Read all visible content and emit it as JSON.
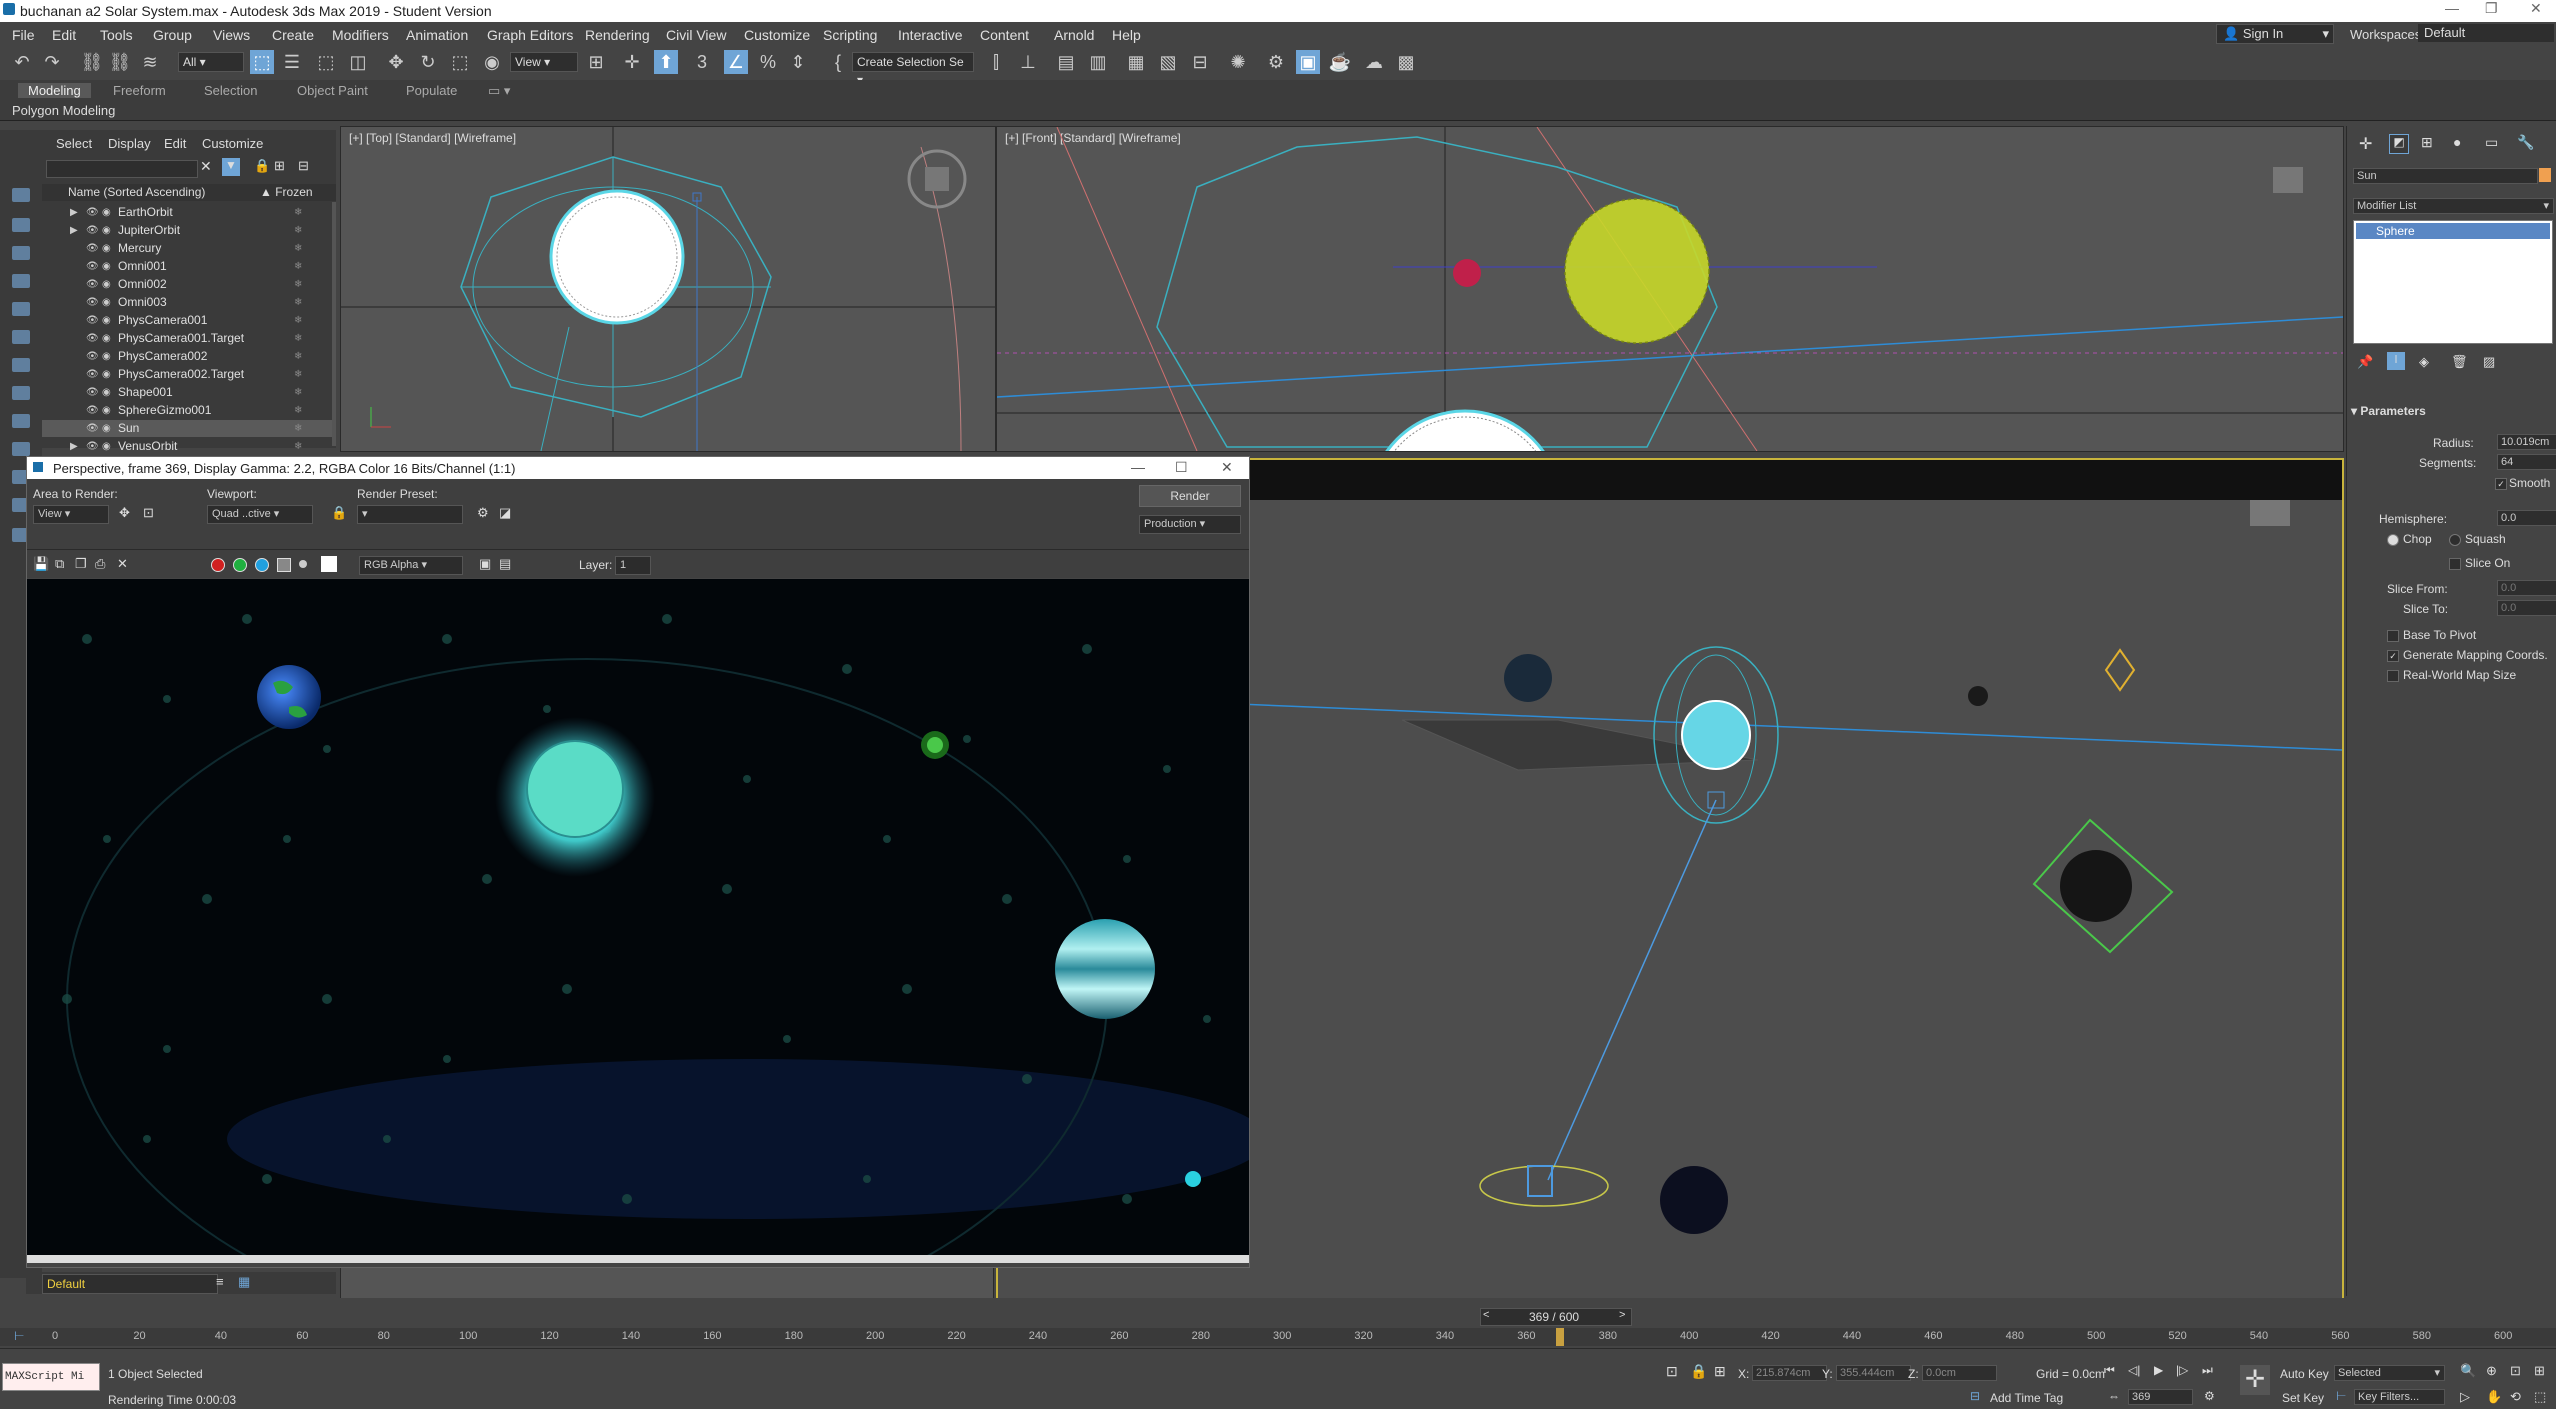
{
  "window": {
    "title": "buchanan a2 Solar System.max - Autodesk 3ds Max 2019 - Student Version",
    "controls": [
      "—",
      "❐",
      "✕"
    ]
  },
  "menu": {
    "items": [
      "File",
      "Edit",
      "Tools",
      "Group",
      "Views",
      "Create",
      "Modifiers",
      "Animation",
      "Graph Editors",
      "Rendering",
      "Civil View",
      "Customize",
      "Scripting",
      "Interactive",
      "Content",
      "Arnold",
      "Help"
    ],
    "sign_in": "Sign In",
    "workspaces_label": "Workspaces:",
    "workspaces_value": "Default"
  },
  "toolbar": {
    "filter_value": "All",
    "coord_value": "View",
    "selection_set": "Create Selection Se"
  },
  "ribbon": {
    "tabs": [
      "Modeling",
      "Freeform",
      "Selection",
      "Object Paint",
      "Populate"
    ],
    "sub": "Polygon Modeling"
  },
  "scene_explorer": {
    "menu": [
      "Select",
      "Display",
      "Edit",
      "Customize"
    ],
    "col_name": "Name (Sorted Ascending)",
    "col_frozen": "▲ Frozen",
    "items": [
      "EarthOrbit",
      "JupiterOrbit",
      "Mercury",
      "Omni001",
      "Omni002",
      "Omni003",
      "PhysCamera001",
      "PhysCamera001.Target",
      "PhysCamera002",
      "PhysCamera002.Target",
      "Shape001",
      "SphereGizmo001",
      "Sun",
      "VenusOrbit"
    ],
    "selected": "Sun"
  },
  "viewports": {
    "top_label": "[+] [Top] [Standard] [Wireframe]",
    "front_label": "[+] [Front] [Standard] [Wireframe]"
  },
  "render_window": {
    "title": "Perspective, frame 369, Display Gamma: 2.2, RGBA Color 16 Bits/Channel (1:1)",
    "area_label": "Area to Render:",
    "area_value": "View",
    "viewport_label": "Viewport:",
    "viewport_value": "Quad ..ctive",
    "preset_label": "Render Preset:",
    "preset_value": "",
    "render_button": "Render",
    "production_value": "Production",
    "channel_value": "RGB Alpha",
    "layer_label": "Layer:",
    "layer_value": "1"
  },
  "command_panel": {
    "object_name": "Sun",
    "modifier_list": "Modifier List",
    "stack_item": "Sphere",
    "rollout": "Parameters",
    "radius_label": "Radius:",
    "radius_value": "10.019cm",
    "segments_label": "Segments:",
    "segments_value": "64",
    "smooth_label": "Smooth",
    "hemisphere_label": "Hemisphere:",
    "hemisphere_value": "0.0",
    "chop_label": "Chop",
    "squash_label": "Squash",
    "slice_on_label": "Slice On",
    "slice_from_label": "Slice From:",
    "slice_from_value": "0.0",
    "slice_to_label": "Slice To:",
    "slice_to_value": "0.0",
    "base_pivot_label": "Base To Pivot",
    "gen_mapping_label": "Generate Mapping Coords.",
    "real_world_label": "Real-World Map Size"
  },
  "timeline": {
    "frame_display": "369 / 600",
    "ticks": [
      "0",
      "20",
      "40",
      "60",
      "80",
      "100",
      "120",
      "140",
      "160",
      "180",
      "200",
      "220",
      "240",
      "260",
      "280",
      "300",
      "320",
      "340",
      "360",
      "380",
      "400",
      "420",
      "440",
      "460",
      "480",
      "500",
      "520",
      "540",
      "560",
      "580",
      "600"
    ],
    "current_frame": 369,
    "total_frames": 600
  },
  "status": {
    "maxscript": "MAXScript Mi",
    "selected": "1 Object Selected",
    "rendering_time": "Rendering Time  0:00:03",
    "layer_default": "Default",
    "x_label": "X:",
    "x_value": "215.874cm",
    "y_label": "Y:",
    "y_value": "355.444cm",
    "z_label": "Z:",
    "z_value": "0.0cm",
    "grid": "Grid = 0.0cm",
    "add_time_tag": "Add Time Tag",
    "auto_key": "Auto Key",
    "set_key": "Set Key",
    "selected_dd": "Selected",
    "key_filters": "Key Filters...",
    "frame_field": "369"
  },
  "colors": {
    "accent": "#6fa5d6",
    "selection": "#5a87c4",
    "ui_bg": "#444444",
    "viewport_bg": "#555555",
    "active_border": "#c8b43c"
  }
}
